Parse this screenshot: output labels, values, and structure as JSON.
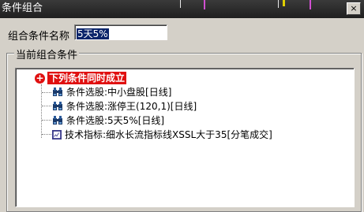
{
  "window": {
    "title": "条件组合",
    "close_symbol": "×"
  },
  "form": {
    "name_label": "组合条件名称",
    "name_value": "5天5%"
  },
  "group": {
    "label": "当前组合条件"
  },
  "tree": {
    "root": {
      "label": "下列条件同时成立",
      "icon": "red-plus-icon"
    },
    "items": [
      {
        "icon": "binoculars-icon",
        "label": "条件选股:中小盘股[日线]"
      },
      {
        "icon": "binoculars-icon",
        "label": "条件选股:涨停王(120,1)[日线]"
      },
      {
        "icon": "binoculars-icon",
        "label": "条件选股:5天5%[日线]"
      },
      {
        "icon": "indicator-chart-icon",
        "label": "技术指标:细水长流指标线XSSL大于35[分笔成交]"
      }
    ]
  },
  "colors": {
    "root_background": "#e01010",
    "selection": "#0a246a",
    "dialog": "#d4d0c8"
  }
}
